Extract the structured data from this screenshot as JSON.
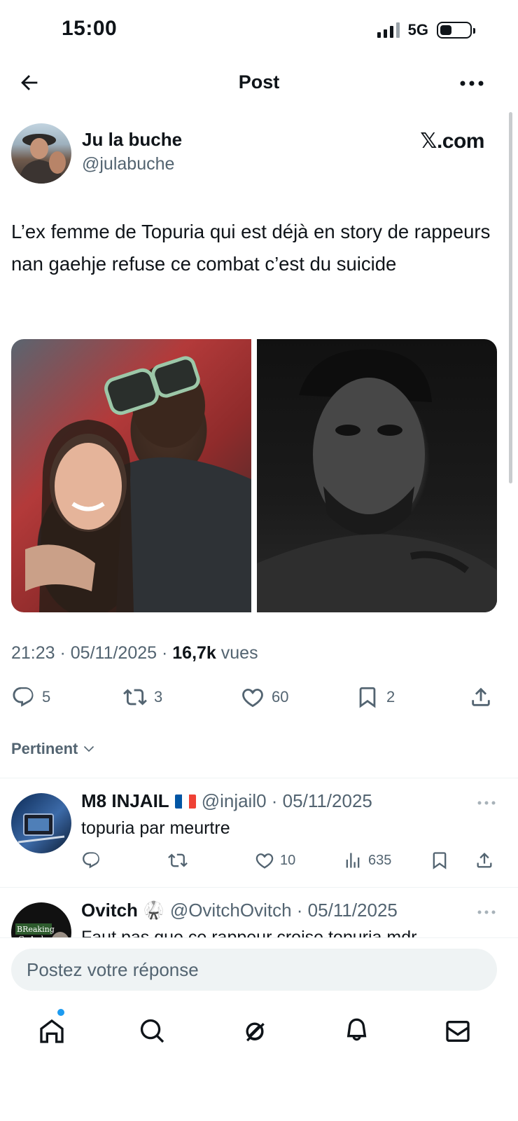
{
  "status_bar": {
    "time": "15:00",
    "network": "5G"
  },
  "header": {
    "title": "Post",
    "back_icon": "arrow-left-icon",
    "more_icon": "more-horizontal-icon"
  },
  "post": {
    "author_name": "Ju la buche",
    "author_handle": "@julabuche",
    "source": "𝕏.com",
    "text": "L’ex femme de Topuria qui est déjà en story de rappeurs nan gaehje refuse ce combat c’est du suicide",
    "meta_time": "21:23 · 05/11/2025 · ",
    "views_count": "16,7k",
    "views_label": " vues",
    "actions": {
      "replies": "5",
      "reposts": "3",
      "likes": "60",
      "bookmarks": "2"
    }
  },
  "sort": {
    "label": "Pertinent"
  },
  "replies": [
    {
      "name": "M8 INJAIL",
      "flag": "France",
      "handle": "@injail0 · 05/11/2025",
      "text": "topuria par meurtre",
      "likes": "10",
      "views": "635"
    },
    {
      "name": "Ovitch",
      "emoji": "🥋",
      "handle": "@OvitchOvitch · 05/11/2025",
      "text": "Faut pas que ce rappeur croise topuria mdr",
      "avatar_text_1": "BReaking",
      "avatar_text_2": "GuArd"
    }
  ],
  "compose": {
    "placeholder": "Postez votre réponse"
  },
  "nav": [
    "home-icon",
    "search-icon",
    "grok-icon",
    "notifications-icon",
    "messages-icon"
  ],
  "colors": {
    "text": "#0f1419",
    "secondary": "#536471",
    "accent": "#1d9bf0",
    "input_bg": "#eff3f4"
  }
}
